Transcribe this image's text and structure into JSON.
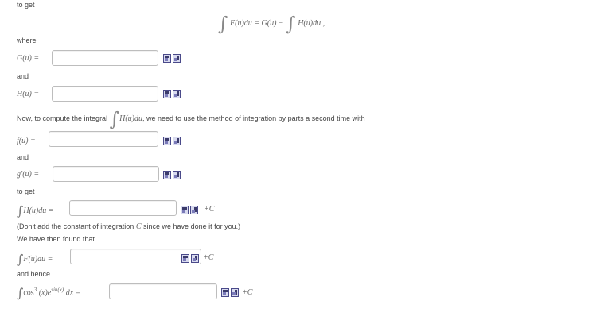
{
  "texts": {
    "to_get_1": "to get",
    "where": "where",
    "and_1": "and",
    "now_prefix": "Now, to compute the integral",
    "now_suffix": ", we need to use the method of integration by parts a second time with",
    "and_2": "and",
    "to_get_2": "to get",
    "note": "(Don't add the constant of integration",
    "note_c": "C",
    "note_end": "since we have done it for you.)",
    "found": "We have then found that",
    "and_hence": "and hence"
  },
  "math": {
    "top_lhs": "F(u)du = G(u) −",
    "top_rhs": "H(u)du ,",
    "G_label": "G(u) =",
    "H_label": "H(u) =",
    "H_inline": "H(u)du",
    "f_label": "f(u) =",
    "gprime_label": "g′(u) =",
    "intH_label": "H(u)du =",
    "intF_label": "F(u)du =",
    "final_cos": "cos",
    "final_cos_exp": "3",
    "final_x": "(x)e",
    "final_sin_exp": "sin(x)",
    "final_dx": "dx =",
    "plus_c": "+C"
  },
  "answers": {
    "G": "",
    "H": "",
    "f": "",
    "gprime": "",
    "intH": "",
    "intF": "",
    "final": ""
  }
}
